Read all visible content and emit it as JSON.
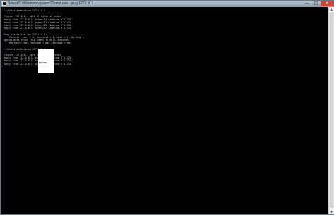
{
  "window": {
    "title": "Select C:\\Windows\\system32\\cmd.exe - ping 127.0.0.1",
    "minimize_glyph": "—",
    "maximize_glyph": "□",
    "close_glyph": "✕"
  },
  "console": {
    "lines": [
      "C:\\Users\\abdev>ping 127.0.0.1",
      "",
      "Pinging 127.0.0.1 with 32 bytes of data:",
      "Reply from 127.0.0.1: bytes=32 time<1ms TTL=128",
      "Reply from 127.0.0.1: bytes=32 time<1ms TTL=128",
      "Reply from 127.0.0.1: bytes=32 time<1ms TTL=128",
      "Reply from 127.0.0.1: bytes=32 time<1ms TTL=128",
      "",
      "Ping statistics for 127.0.0.1:",
      "    Packets: Sent = 4, Received = 4, Lost = 0 (0% loss),",
      "Approximate round trip times in milli-seconds:",
      "    Minimum = 0ms, Maximum = 0ms, Average = 0ms",
      "",
      "C:\\Users\\abdev>ping 127.0.0.1",
      "",
      "Pinging 127.0.0.1 with 32 bytes of data:",
      "Reply from 127.0.0.1: bytes=32 time<1ms TTL=128",
      "Reply from 127.0.0.1: bytes=32 time<1ms TTL=128",
      "Reply from 127.0.0.1: bytes=32 time<1ms TTL=128"
    ],
    "selection_text": "bytes"
  },
  "scrollbar": {
    "up_glyph": "▲",
    "down_glyph": "▼"
  }
}
